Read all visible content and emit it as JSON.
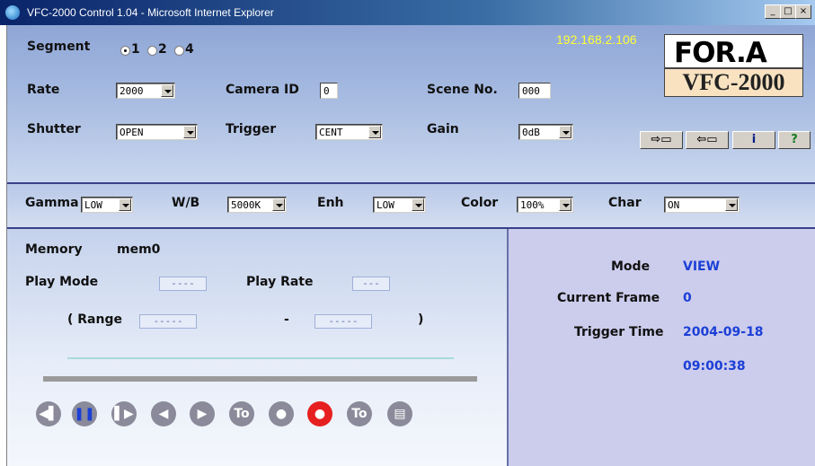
{
  "window": {
    "title": "VFC-2000 Control 1.04 - Microsoft Internet Explorer",
    "min": "_",
    "max": "□",
    "close": "×"
  },
  "ip_address": "192.168.2.106",
  "brand": {
    "logo_text": "FOR.A",
    "model": "VFC-2000"
  },
  "segment": {
    "label": "Segment",
    "options": [
      "1",
      "2",
      "4"
    ],
    "selected": "1"
  },
  "rate": {
    "label": "Rate",
    "value": "2000"
  },
  "camera_id": {
    "label": "Camera ID",
    "value": "0"
  },
  "scene_no": {
    "label": "Scene No.",
    "value": "000"
  },
  "shutter": {
    "label": "Shutter",
    "value": "OPEN"
  },
  "trigger": {
    "label": "Trigger",
    "value": "CENT"
  },
  "gain": {
    "label": "Gain",
    "value": "0dB"
  },
  "icons": [
    "import-icon",
    "export-icon",
    "info-icon",
    "help-icon"
  ],
  "gamma": {
    "label": "Gamma",
    "value": "LOW"
  },
  "wb": {
    "label": "W/B",
    "value": "5000K"
  },
  "enh": {
    "label": "Enh",
    "value": "LOW"
  },
  "color": {
    "label": "Color",
    "value": "100%"
  },
  "char": {
    "label": "Char",
    "value": "ON"
  },
  "memory": {
    "label": "Memory",
    "value": "mem0"
  },
  "play_mode": {
    "label": "Play Mode",
    "value": "----"
  },
  "play_rate": {
    "label": "Play Rate",
    "value": "---"
  },
  "range": {
    "open": "( Range",
    "start": "-----",
    "dash": "-",
    "end": "-----",
    "close": ")"
  },
  "status": {
    "mode_label": "Mode",
    "mode_value": "VIEW",
    "frame_label": "Current Frame",
    "frame_value": "0",
    "trigger_label": "Trigger Time",
    "trigger_date": "2004-09-18",
    "trigger_time": "09:00:38"
  },
  "controls": [
    {
      "name": "skip-back-icon",
      "glyph": "◀▌"
    },
    {
      "name": "pause-icon",
      "glyph": "❚❚"
    },
    {
      "name": "skip-forward-icon",
      "glyph": "▌▶"
    },
    {
      "name": "play-reverse-icon",
      "glyph": "◀"
    },
    {
      "name": "play-icon",
      "glyph": "▶"
    },
    {
      "name": "to-start-icon",
      "glyph": "To"
    },
    {
      "name": "stop-icon",
      "glyph": "●"
    },
    {
      "name": "record-icon",
      "glyph": "●"
    },
    {
      "name": "to-end-icon",
      "glyph": "To"
    },
    {
      "name": "save-icon",
      "glyph": "▤"
    }
  ],
  "colors": {
    "accent_blue": "#1b3fd6",
    "ip_yellow": "#ffff33",
    "record_red": "#e62020"
  }
}
